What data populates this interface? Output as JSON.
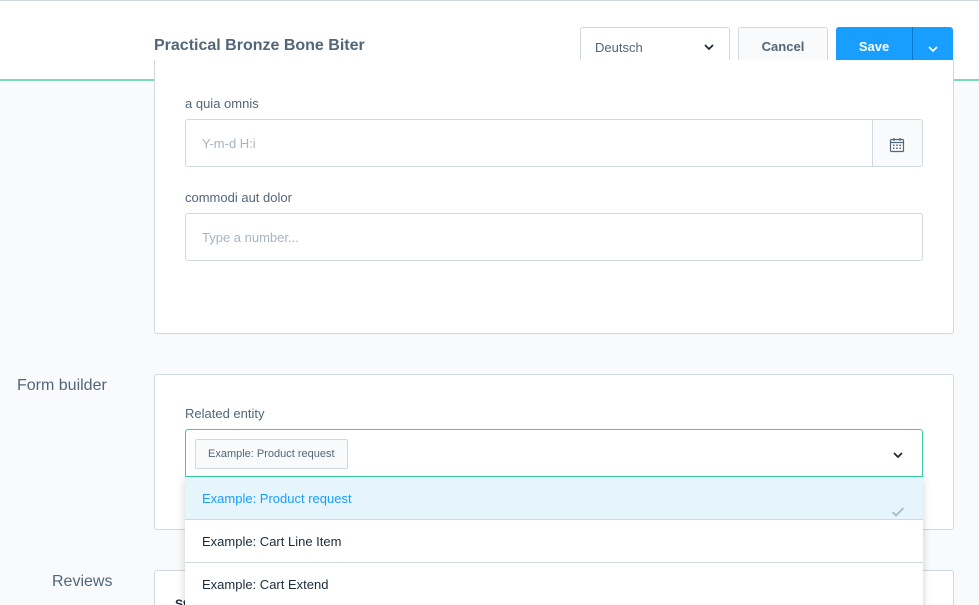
{
  "header": {
    "title": "Practical Bronze Bone Biter",
    "language": "Deutsch",
    "cancel_label": "Cancel",
    "save_label": "Save"
  },
  "fields": {
    "date_field": {
      "label": "a quia omnis",
      "placeholder": "Y-m-d H:i"
    },
    "number_field": {
      "label": "commodi aut dolor",
      "placeholder": "Type a number..."
    }
  },
  "form_builder": {
    "section_label": "Form builder",
    "related_entity_label": "Related entity",
    "selected": "Example: Product request",
    "options": [
      {
        "label": "Example: Product request",
        "selected": true
      },
      {
        "label": "Example: Cart Line Item",
        "selected": false
      },
      {
        "label": "Example: Cart Extend",
        "selected": false
      }
    ]
  },
  "reviews": {
    "section_label": "Reviews",
    "partial_text": "St"
  },
  "colors": {
    "accent": "#189eff",
    "focus_border": "#37d0a3",
    "header_border": "#7ad9b6",
    "text": "#52667a"
  }
}
